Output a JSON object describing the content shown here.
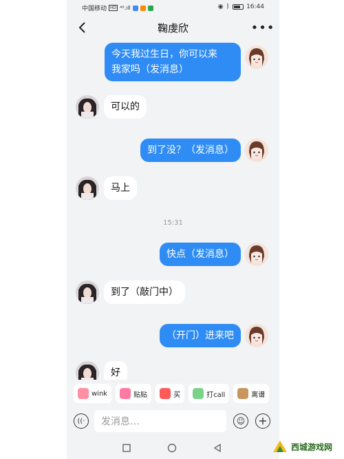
{
  "status_bar": {
    "carrier": "中国移动",
    "hd": "HD",
    "signal": "⁴⁶.ıll",
    "time": "16:44"
  },
  "header": {
    "title": "鞠虔欣",
    "back_icon": "chevron-left-icon",
    "more_label": "•••"
  },
  "messages": [
    {
      "side": "out",
      "lines": [
        "今天我过生日，你可以来",
        "我家吗（发消息）"
      ]
    },
    {
      "side": "in",
      "lines": [
        "可以的"
      ]
    },
    {
      "side": "out",
      "lines": [
        "到了没？（发消息）"
      ]
    },
    {
      "side": "in",
      "lines": [
        "马上"
      ]
    },
    {
      "side": "out",
      "lines": [
        "快点（发消息）"
      ]
    },
    {
      "side": "in",
      "lines": [
        "到了（敲门中）"
      ]
    },
    {
      "side": "out",
      "lines": [
        "（开门）进来吧"
      ]
    },
    {
      "side": "in",
      "lines": [
        "好"
      ]
    }
  ],
  "timestamp": "15:31",
  "quick_actions": [
    {
      "label": "wink",
      "icon": "wink-icon",
      "color": "#ff8fa3"
    },
    {
      "label": "贴贴",
      "icon": "hug-icon",
      "color": "#ff7aa2"
    },
    {
      "label": "买",
      "icon": "gift-icon",
      "color": "#ff5a5a"
    },
    {
      "label": "打call",
      "icon": "cheer-icon",
      "color": "#7bd389"
    },
    {
      "label": "离谱",
      "icon": "monkey-icon",
      "color": "#c9955e"
    }
  ],
  "input": {
    "placeholder": "发消息…"
  },
  "colors": {
    "outgoing_bubble": "#2f8cf4",
    "incoming_bubble": "#ffffff",
    "background": "#f2f3f5"
  },
  "watermark": {
    "text": "西城游戏网"
  }
}
